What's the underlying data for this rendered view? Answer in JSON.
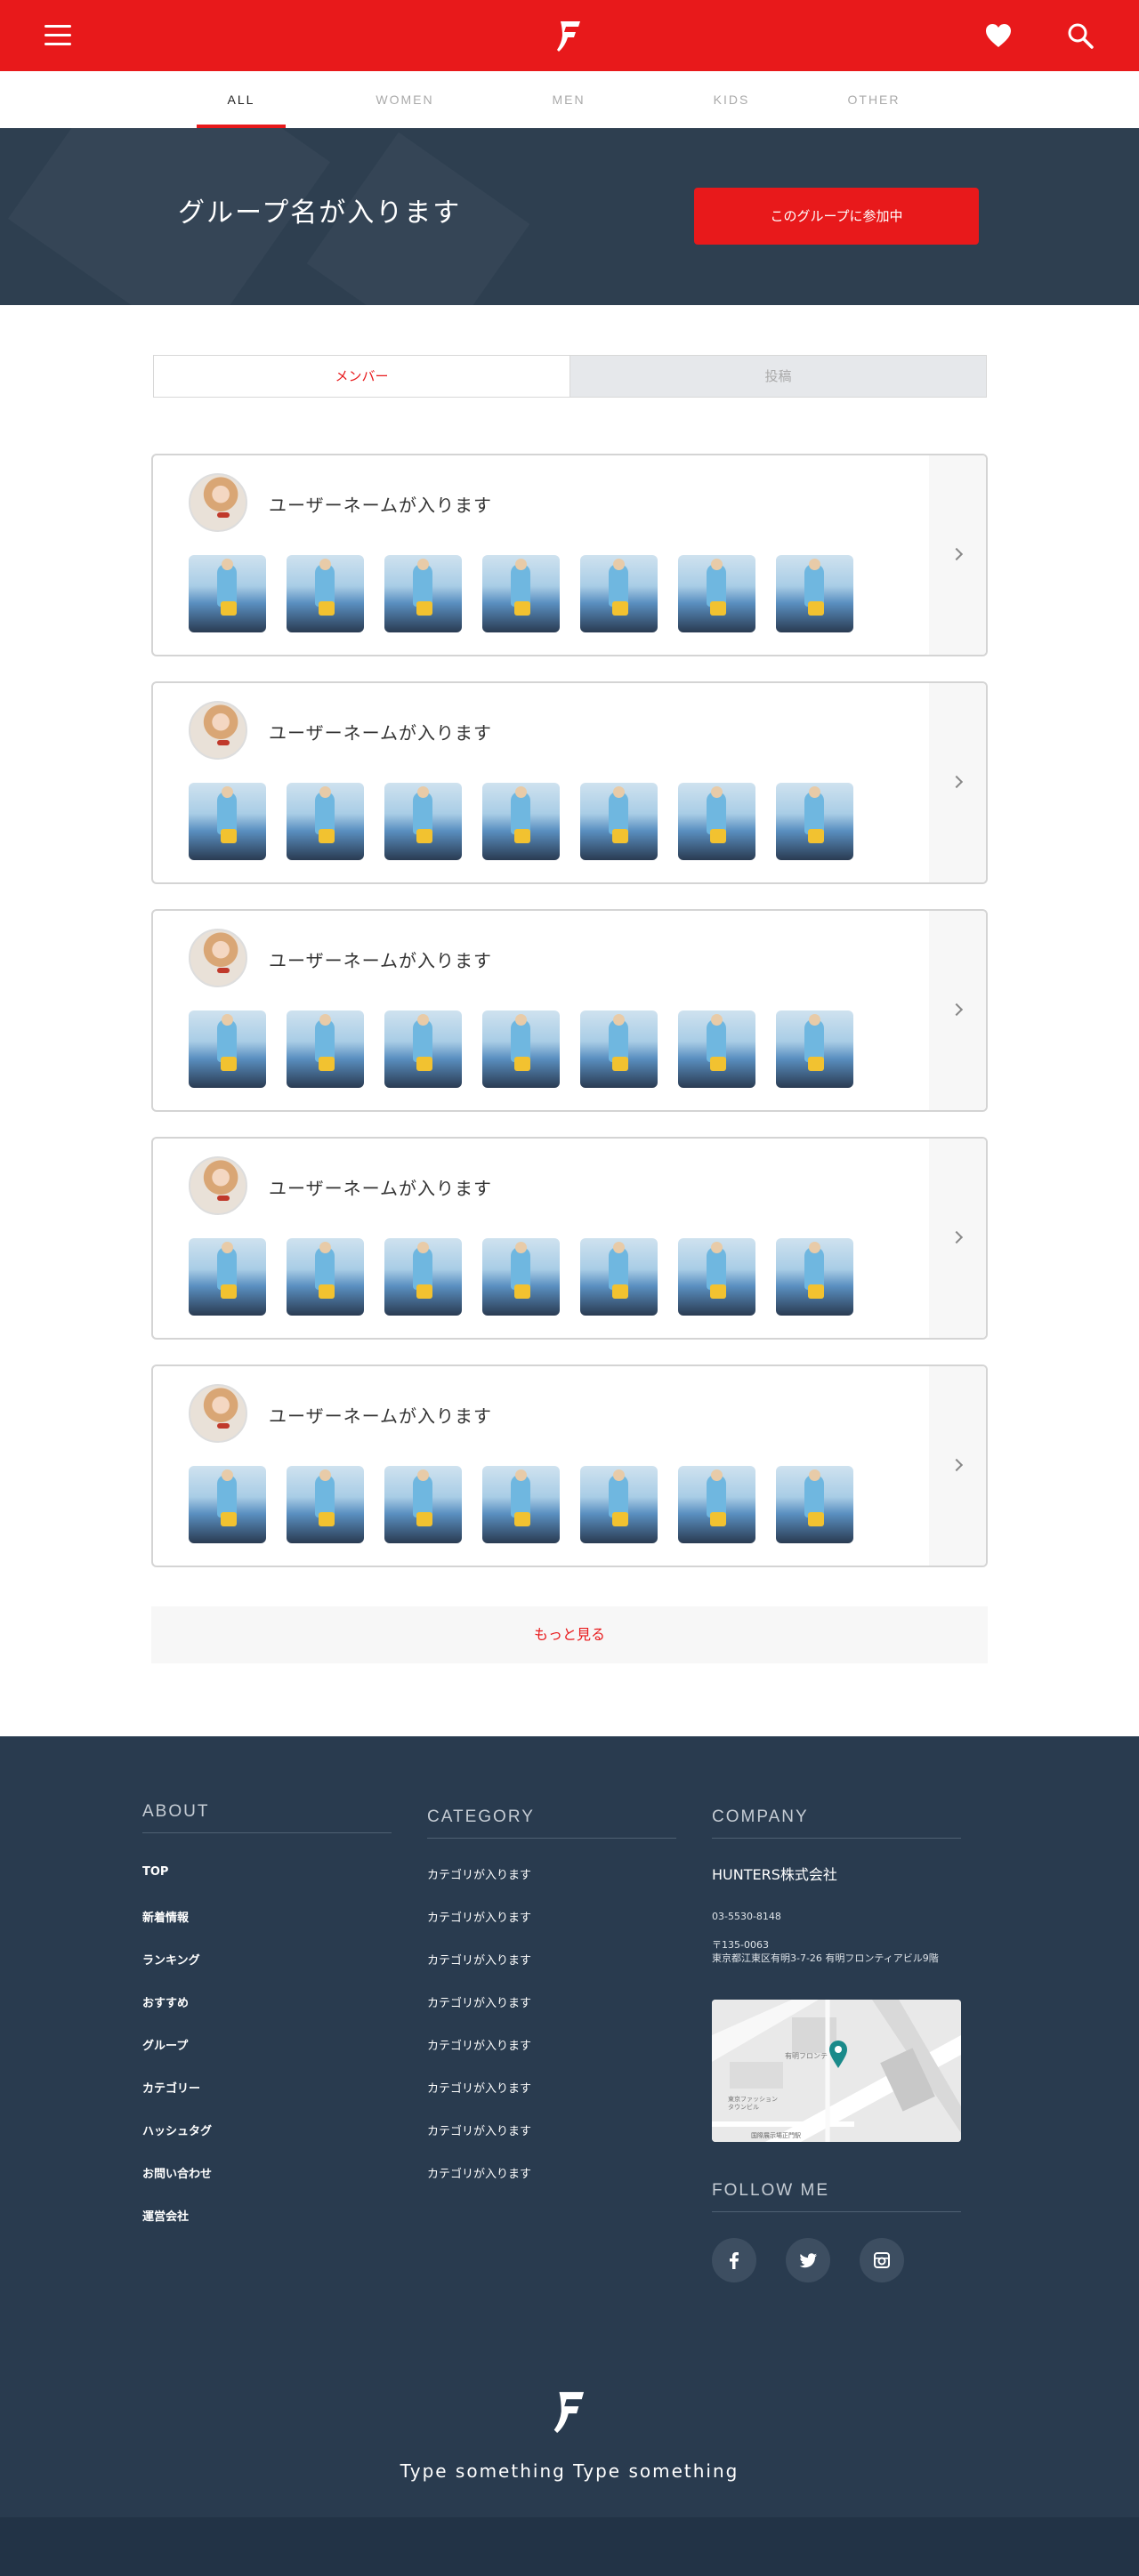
{
  "header": {
    "tabs": [
      {
        "label": "ALL",
        "active": true
      },
      {
        "label": "WOMEN",
        "active": false
      },
      {
        "label": "MEN",
        "active": false
      },
      {
        "label": "KIDS",
        "active": false
      },
      {
        "label": "OTHER",
        "active": false
      }
    ]
  },
  "hero": {
    "title": "グループ名が入ります",
    "join_label": "このグループに参加中"
  },
  "toggle": {
    "members_label": "メンバー",
    "posts_label": "投稿"
  },
  "members": [
    {
      "username": "ユーザーネームが入ります"
    },
    {
      "username": "ユーザーネームが入ります"
    },
    {
      "username": "ユーザーネームが入ります"
    },
    {
      "username": "ユーザーネームが入ります"
    },
    {
      "username": "ユーザーネームが入ります"
    }
  ],
  "more_label": "もっと見る",
  "footer": {
    "about": {
      "title": "ABOUT",
      "links": [
        "TOP",
        "新着情報",
        "ランキング",
        "おすすめ",
        "グループ",
        "カテゴリー",
        "ハッシュタグ",
        "お問い合わせ",
        "運営会社"
      ]
    },
    "category": {
      "title": "CATEGORY",
      "links": [
        "カテゴリが入ります",
        "カテゴリが入ります",
        "カテゴリが入ります",
        "カテゴリが入ります",
        "カテゴリが入ります",
        "カテゴリが入ります",
        "カテゴリが入ります",
        "カテゴリが入ります"
      ]
    },
    "company": {
      "title": "COMPANY",
      "name": "HUNTERS株式会社",
      "phone": "03-5530-8148",
      "postal": "〒135-0063",
      "address": "東京都江東区有明3-7-26 有明フロンティアビル9階",
      "map_labels": [
        "有明フロンテ",
        "東京ファッションタウンビル",
        "国際展示場正門駅"
      ]
    },
    "follow": {
      "title": "FOLLOW ME",
      "icons": [
        "facebook-icon",
        "twitter-icon",
        "instagram-icon"
      ]
    },
    "tagline": "Type something Type something"
  },
  "colors": {
    "brand_red": "#e8191b",
    "navy": "#293b4f",
    "hero": "#2e3f50"
  }
}
